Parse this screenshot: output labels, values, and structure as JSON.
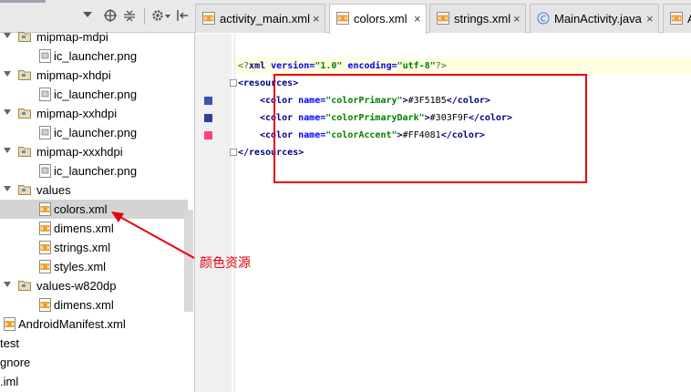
{
  "tabs": [
    {
      "label": "activity_main.xml",
      "icon": "xml-file-icon",
      "active": false,
      "close": "×"
    },
    {
      "label": "colors.xml",
      "icon": "xml-file-icon",
      "active": true,
      "close": "×"
    },
    {
      "label": "strings.xml",
      "icon": "xml-file-icon",
      "active": false,
      "close": "×"
    },
    {
      "label": "MainActivity.java",
      "icon": "java-class-icon",
      "active": false,
      "close": "×"
    },
    {
      "label": "A",
      "icon": "xml-file-icon",
      "active": false,
      "close": ""
    }
  ],
  "tree": [
    {
      "label": "mipmap-mdpi",
      "type": "folder",
      "level": 1,
      "expanded": true
    },
    {
      "label": "ic_launcher.png",
      "type": "png",
      "level": 2
    },
    {
      "label": "mipmap-xhdpi",
      "type": "folder",
      "level": 1,
      "expanded": true
    },
    {
      "label": "ic_launcher.png",
      "type": "png",
      "level": 2
    },
    {
      "label": "mipmap-xxhdpi",
      "type": "folder",
      "level": 1,
      "expanded": true
    },
    {
      "label": "ic_launcher.png",
      "type": "png",
      "level": 2
    },
    {
      "label": "mipmap-xxxhdpi",
      "type": "folder",
      "level": 1,
      "expanded": true
    },
    {
      "label": "ic_launcher.png",
      "type": "png",
      "level": 2
    },
    {
      "label": "values",
      "type": "folder",
      "level": 1,
      "expanded": true
    },
    {
      "label": "colors.xml",
      "type": "xml",
      "level": 2,
      "selected": true
    },
    {
      "label": "dimens.xml",
      "type": "xml",
      "level": 2
    },
    {
      "label": "strings.xml",
      "type": "xml",
      "level": 2
    },
    {
      "label": "styles.xml",
      "type": "xml",
      "level": 2
    },
    {
      "label": "values-w820dp",
      "type": "folder",
      "level": 1,
      "expanded": true
    },
    {
      "label": "dimens.xml",
      "type": "xml",
      "level": 2
    },
    {
      "label": "AndroidManifest.xml",
      "type": "manifest",
      "level": 0
    },
    {
      "label": "test",
      "type": "none",
      "level": -1
    },
    {
      "label": "gnore",
      "type": "none",
      "level": -1
    },
    {
      "label": ".iml",
      "type": "none",
      "level": -1
    }
  ],
  "code": {
    "declaration": {
      "open": "<?",
      "name": "xml",
      "attr1": " version=",
      "val1": "\"1.0\"",
      "attr2": " encoding=",
      "val2": "\"utf-8\"",
      "close": "?>"
    },
    "resources_open": "<resources>",
    "colors": [
      {
        "name": "colorPrimary",
        "value": "#3F51B5",
        "swatch": "#3F51B5"
      },
      {
        "name": "colorPrimaryDark",
        "value": "#303F9F",
        "swatch": "#303F9F"
      },
      {
        "name": "colorAccent",
        "value": "#FF4081",
        "swatch": "#FF4081"
      }
    ],
    "color_tag_open": "<color",
    "name_attr": " name=",
    "color_tag_close": "</color>",
    "resources_close": "</resources>"
  },
  "annotation": {
    "text": "颜色资源",
    "color": "#e60012"
  }
}
